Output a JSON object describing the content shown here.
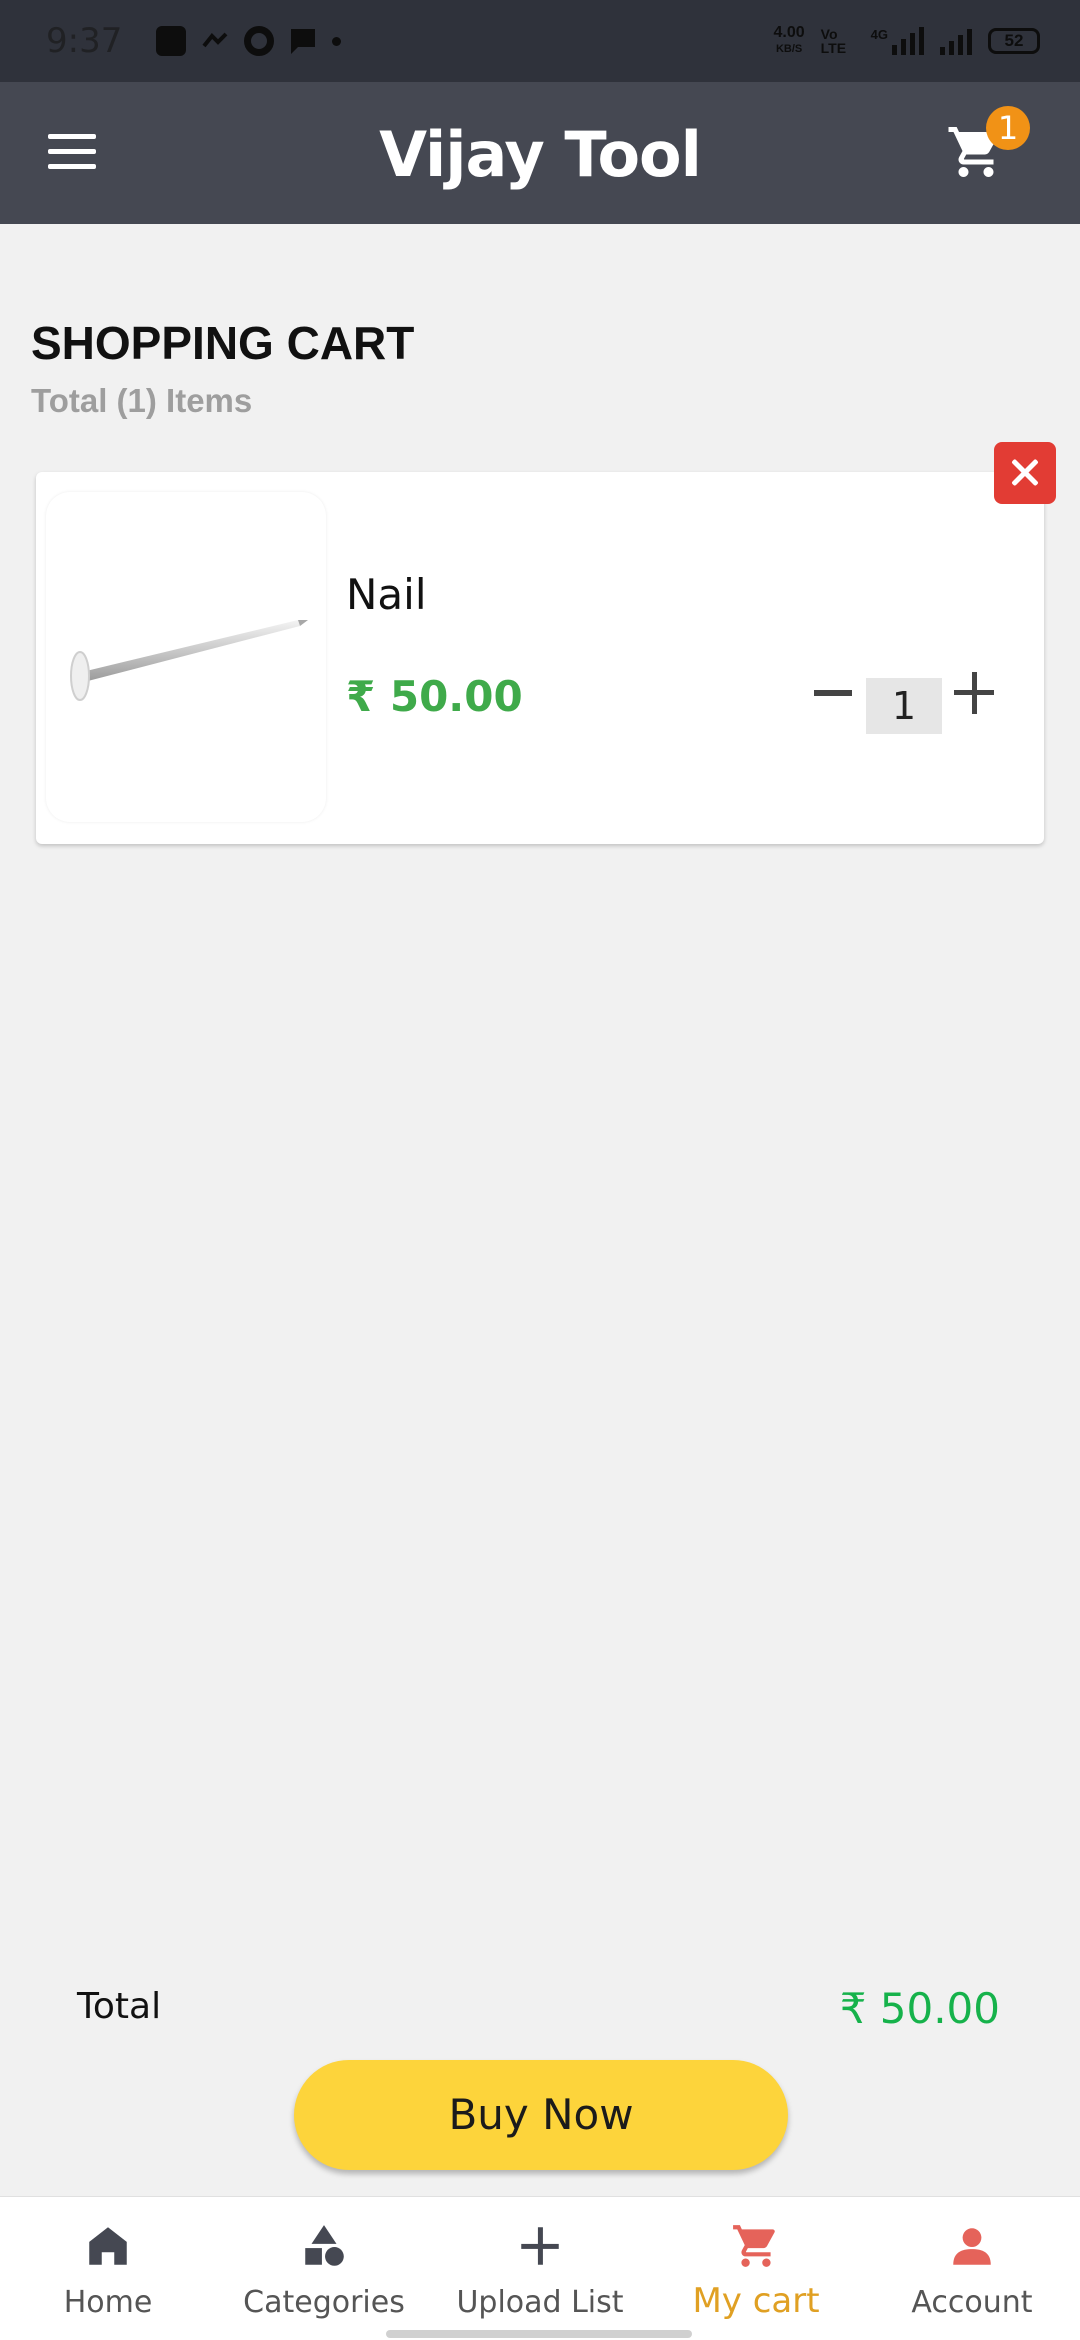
{
  "status_bar": {
    "time": "9:37",
    "net_speed_value": "4.00",
    "net_speed_unit": "KB/S",
    "volte": "Vo LTE",
    "network": "4G",
    "battery": "52"
  },
  "app_bar": {
    "title": "Vijay Tool",
    "cart_badge": "1"
  },
  "cart": {
    "heading": "SHOPPING CART",
    "count_text": "Total (1) Items",
    "items": [
      {
        "name": "Nail",
        "price": "₹ 50.00",
        "quantity": "1"
      }
    ]
  },
  "summary": {
    "total_label": "Total",
    "total_value": "₹ 50.00",
    "buy_label": "Buy Now"
  },
  "bottom_nav": {
    "items": [
      {
        "label": "Home",
        "icon": "home-icon"
      },
      {
        "label": "Categories",
        "icon": "categories-icon"
      },
      {
        "label": "Upload List",
        "icon": "plus-icon"
      },
      {
        "label": "My cart",
        "icon": "cart-icon",
        "active": true
      },
      {
        "label": "Account",
        "icon": "account-icon"
      }
    ]
  },
  "colors": {
    "app_bar": "#454852",
    "price_green": "#3faa4a",
    "total_green": "#16b24b",
    "buy_button": "#fdd43b",
    "remove_button": "#e23c34",
    "badge": "#f19216",
    "active_nav": "#e0a023"
  }
}
